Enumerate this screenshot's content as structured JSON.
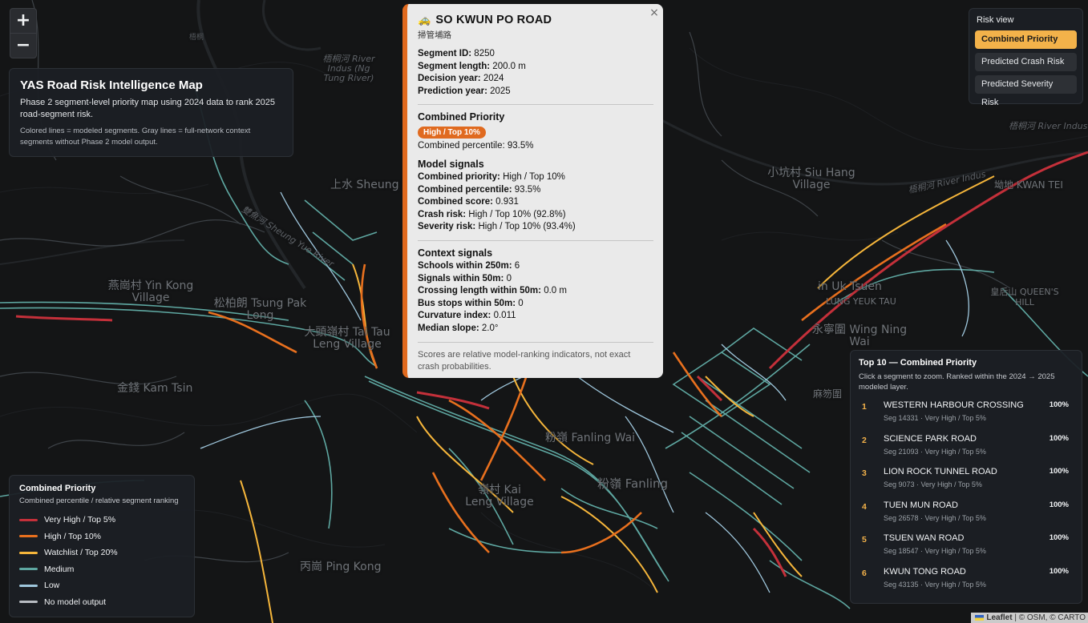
{
  "zoom": {
    "in": "+",
    "out": "−"
  },
  "info": {
    "title": "YAS Road Risk Intelligence Map",
    "description": "Phase 2 segment-level priority map using 2024 data to rank 2025 road-segment risk.",
    "note": "Colored lines = modeled segments. Gray lines = full-network context segments without Phase 2 model output."
  },
  "risk_view": {
    "header": "Risk view",
    "options": [
      "Combined Priority",
      "Predicted Crash Risk",
      "Predicted Severity Risk"
    ],
    "active": "Combined Priority"
  },
  "legend": {
    "title": "Combined Priority",
    "subtitle": "Combined percentile / relative segment ranking",
    "items": [
      {
        "label": "Very High / Top 5%",
        "color": "#c4303a"
      },
      {
        "label": "High / Top 10%",
        "color": "#e8701e"
      },
      {
        "label": "Watchlist / Top 20%",
        "color": "#f6b63b"
      },
      {
        "label": "Medium",
        "color": "#5ea7a1"
      },
      {
        "label": "Low",
        "color": "#9fc7dd"
      },
      {
        "label": "No model output",
        "color": "#b8bcc2"
      }
    ]
  },
  "top10": {
    "title": "Top 10 — Combined Priority",
    "subtitle": "Click a segment to zoom. Ranked within the 2024 → 2025 modeled layer.",
    "items": [
      {
        "rank": "1",
        "name": "WESTERN HARBOUR CROSSING",
        "meta": "Seg 14331 · Very High / Top 5%",
        "pct": "100%"
      },
      {
        "rank": "2",
        "name": "SCIENCE PARK ROAD",
        "meta": "Seg 21093 · Very High / Top 5%",
        "pct": "100%"
      },
      {
        "rank": "3",
        "name": "LION ROCK TUNNEL ROAD",
        "meta": "Seg 9073 · Very High / Top 5%",
        "pct": "100%"
      },
      {
        "rank": "4",
        "name": "TUEN MUN ROAD",
        "meta": "Seg 26578 · Very High / Top 5%",
        "pct": "100%"
      },
      {
        "rank": "5",
        "name": "TSUEN WAN ROAD",
        "meta": "Seg 18547 · Very High / Top 5%",
        "pct": "100%"
      },
      {
        "rank": "6",
        "name": "KWUN TONG ROAD",
        "meta": "Seg 43135 · Very High / Top 5%",
        "pct": "100%"
      }
    ]
  },
  "popup": {
    "close": "×",
    "icon": "car-icon",
    "title": "SO KWUN PO ROAD",
    "title_zh": "掃管埔路",
    "details": [
      {
        "k": "Segment ID:",
        "v": "8250"
      },
      {
        "k": "Segment length:",
        "v": "200.0 m"
      },
      {
        "k": "Decision year:",
        "v": "2024"
      },
      {
        "k": "Prediction year:",
        "v": "2025"
      }
    ],
    "combined": {
      "heading": "Combined Priority",
      "badge": "High / Top 10%",
      "percentile_label": "Combined percentile:",
      "percentile_value": "93.5%"
    },
    "model_heading": "Model signals",
    "model": [
      {
        "k": "Combined priority:",
        "v": "High / Top 10%"
      },
      {
        "k": "Combined percentile:",
        "v": "93.5%"
      },
      {
        "k": "Combined score:",
        "v": "0.931"
      },
      {
        "k": "Crash risk:",
        "v": "High / Top 10% (92.8%)"
      },
      {
        "k": "Severity risk:",
        "v": "High / Top 10% (93.4%)"
      }
    ],
    "context_heading": "Context signals",
    "context": [
      {
        "k": "Schools within 250m:",
        "v": "6"
      },
      {
        "k": "Signals within 50m:",
        "v": "0"
      },
      {
        "k": "Crossing length within 50m:",
        "v": "0.0 m"
      },
      {
        "k": "Bus stops within 50m:",
        "v": "0"
      },
      {
        "k": "Curvature index:",
        "v": "0.011"
      },
      {
        "k": "Median slope:",
        "v": "2.0°"
      }
    ],
    "footnote": "Scores are relative model-ranking indicators, not exact crash probabilities."
  },
  "map_labels": [
    "上水 Sheung Wai",
    "燕崗村 Yin Kong Village",
    "松柏朗 Tsung Pak Long",
    "大頭嶺村 Tai Tau Leng Village",
    "金錢 Kam Tsin",
    "粉嶺 Fanling Wai",
    "粉嶺 Fanling",
    "嶺村 Kai Leng Village",
    "丙崗 Ping Kong",
    "小坑村 Siu Hang Village",
    "坳地 KWAN TEI",
    "in Uk Tsuen",
    "皇后山 QUEEN'S HILL",
    "LUNG YEUK TAU",
    "永寧圍 Wing Ning Wai",
    "麻笏圍",
    "梧桐河 River Indus (Ng Tung River)",
    "梧桐河 River Indus",
    "梧桐河 River Indus",
    "雙魚河 Sheung Yue River",
    "梧桐"
  ],
  "attribution": {
    "leaflet": "Leaflet",
    "rest": " | © OSM, © CARTO"
  }
}
